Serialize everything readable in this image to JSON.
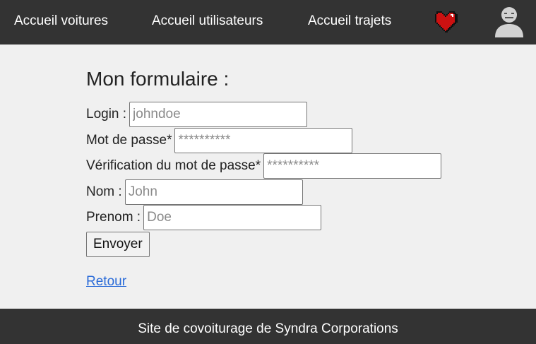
{
  "nav": {
    "links": [
      {
        "label": "Accueil voitures"
      },
      {
        "label": "Accueil utilisateurs"
      },
      {
        "label": "Accueil trajets"
      }
    ],
    "icons": [
      "heart-icon",
      "user-avatar-icon"
    ]
  },
  "form": {
    "title": "Mon formulaire :",
    "login_label": "Login :",
    "login_placeholder": "johndoe",
    "password_label": "Mot de passe*",
    "password_placeholder": "**********",
    "password_confirm_label": "Vérification du mot de passe*",
    "password_confirm_placeholder": "**********",
    "lastname_label": "Nom :",
    "lastname_placeholder": "John",
    "firstname_label": "Prenom :",
    "firstname_placeholder": "Doe",
    "submit_label": "Envoyer"
  },
  "back_link": "Retour",
  "footer": {
    "text": "Site de covoiturage de Syndra Corporations"
  },
  "colors": {
    "nav_bg": "#333333",
    "page_bg": "#f0f0f0",
    "link": "#2a6bd8",
    "heart": "#cc1111"
  }
}
